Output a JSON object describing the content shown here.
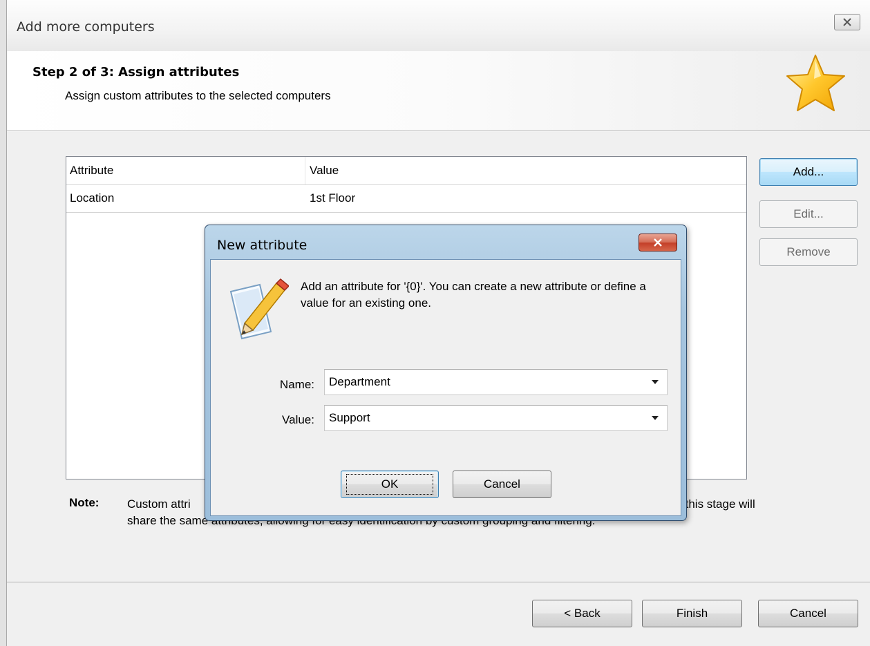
{
  "window": {
    "title": "Add more computers"
  },
  "header": {
    "step_title": "Step 2 of 3: Assign attributes",
    "step_subtitle": "Assign custom attributes to the selected computers"
  },
  "grid": {
    "columns": [
      "Attribute",
      "Value"
    ],
    "rows": [
      {
        "attribute": "Location",
        "value": "1st Floor"
      }
    ]
  },
  "side_buttons": {
    "add": "Add...",
    "edit": "Edit...",
    "remove": "Remove"
  },
  "note": {
    "label": "Note:",
    "text_visible_left": "Custom attri",
    "text_visible_right": "ded at this stage will",
    "text_line2": "share the same attributes, allowing for easy identification by custom grouping and filtering."
  },
  "footer": {
    "back": "< Back",
    "finish": "Finish",
    "cancel": "Cancel"
  },
  "dialog": {
    "title": "New attribute",
    "message": "Add an attribute for '{0}'. You can create a new attribute or define a value for an existing one.",
    "name_label": "Name:",
    "name_value": "Department",
    "value_label": "Value:",
    "value_value": "Support",
    "ok": "OK",
    "cancel": "Cancel"
  },
  "icons": {
    "header": "star-icon",
    "dialog": "pencil-note-icon"
  }
}
